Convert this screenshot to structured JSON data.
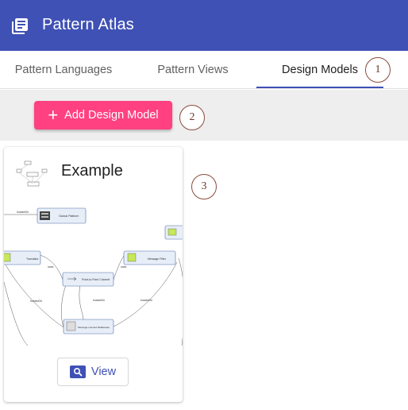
{
  "app": {
    "title": "Pattern Atlas",
    "icon": "library-books-icon"
  },
  "tabs": [
    {
      "label": "Pattern Languages",
      "active": false
    },
    {
      "label": "Pattern Views",
      "active": false
    },
    {
      "label": "Design Models",
      "active": true
    }
  ],
  "toolbar": {
    "add_label": "Add Design Model",
    "add_icon": "plus-icon"
  },
  "annotations": [
    "1",
    "2",
    "3"
  ],
  "card": {
    "title": "Example",
    "view_label": "View",
    "view_icon": "search-icon",
    "diagram": {
      "nodes": [
        "Classic Platform",
        "Translator",
        "Point-to-Point Channel",
        "Message Filter",
        "Message-oriented Middleware"
      ],
      "edge_labels": [
        "hostedOn",
        "uses",
        "uses",
        "hostedOn",
        "hostedOn",
        "hostedOn"
      ]
    }
  },
  "colors": {
    "primary": "#3f51b5",
    "accent": "#ff4081",
    "toolbar_bg": "#eeeeee"
  }
}
